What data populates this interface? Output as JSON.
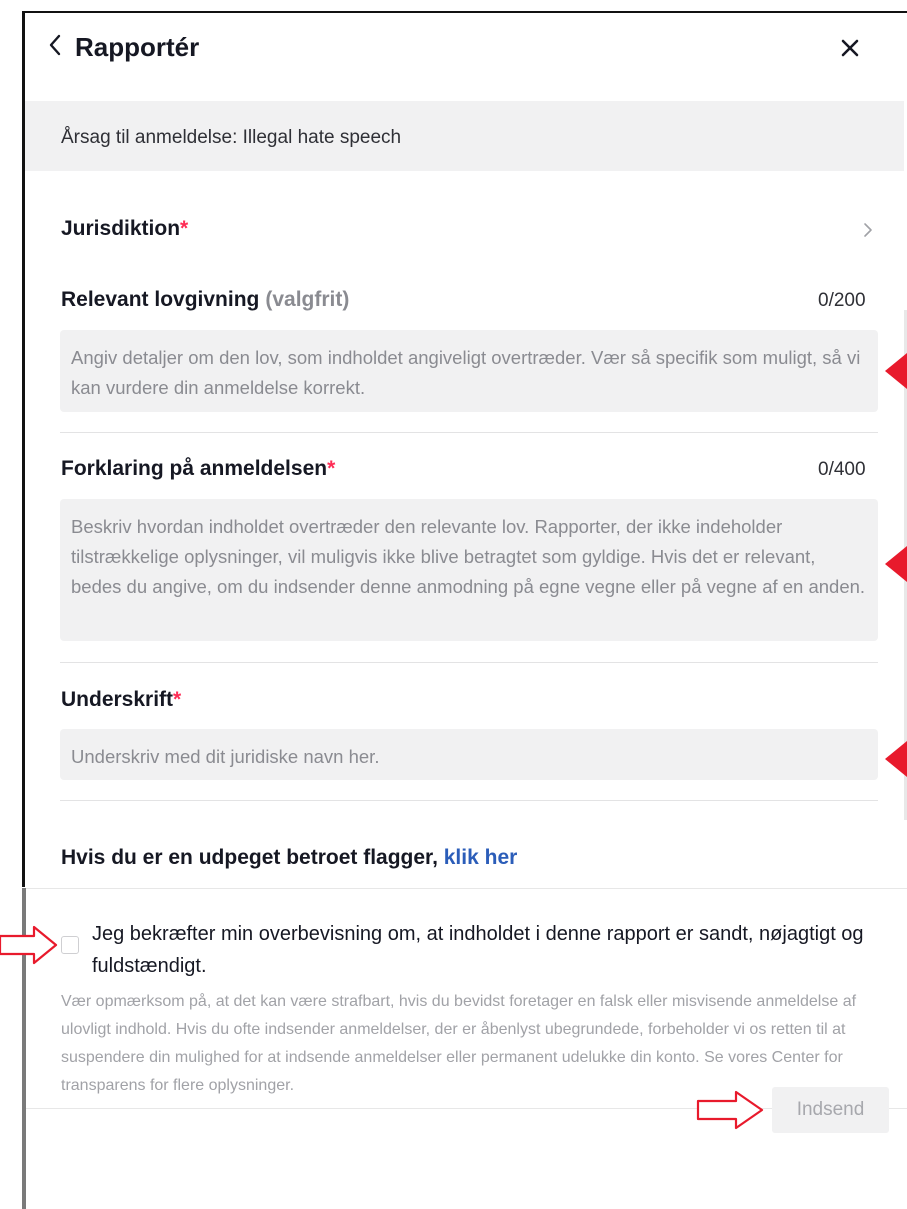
{
  "header": {
    "title": "Rapportér",
    "back_icon": "chevron-left-icon",
    "close_icon": "close-icon"
  },
  "reason": {
    "text": "Årsag til anmeldelse: Illegal hate speech"
  },
  "jurisdiction": {
    "label": "Jurisdiktion",
    "required_mark": "*"
  },
  "legislation": {
    "label": "Relevant lovgivning",
    "optional_label": "(valgfrit)",
    "counter": "0/200",
    "placeholder": "Angiv detaljer om den lov, som indholdet angiveligt overtræder. Vær så specifik som muligt, så vi kan vurdere din anmeldelse korrekt."
  },
  "explanation": {
    "label": "Forklaring på anmeldelsen",
    "required_mark": "*",
    "counter": "0/400",
    "placeholder": "Beskriv hvordan indholdet overtræder den relevante lov. Rapporter, der ikke indeholder tilstrækkelige oplysninger, vil muligvis ikke blive betragtet som gyldige. Hvis det er relevant, bedes du angive, om du indsender denne anmodning på egne vegne eller på vegne af en anden."
  },
  "signature": {
    "label": "Underskrift",
    "required_mark": "*",
    "placeholder": "Underskriv med dit juridiske navn her."
  },
  "flagger": {
    "text": "Hvis du er en udpeget betroet flagger,",
    "link": "klik her"
  },
  "confirm": {
    "checked": false,
    "text": "Jeg bekræfter min overbevisning om, at indholdet i denne rapport er sandt, nøjagtigt og fuldstændigt."
  },
  "legal_notice": "Vær opmærksom på, at det kan være strafbart, hvis du bevidst foretager en falsk eller misvisende anmeldelse af ulovligt indhold. Hvis du ofte indsender anmeldelser, der er åbenlyst ubegrundede, forbeholder vi os retten til at suspendere din mulighed for at indsende anmeldelser eller permanent udelukke din konto. Se vores Center for transparens for flere oplysninger.",
  "submit": {
    "label": "Indsend",
    "enabled": false
  },
  "colors": {
    "required": "#fe2c55",
    "link": "#2b5db9",
    "annotation_marker": "#e81a2c",
    "input_bg": "#f1f1f2"
  }
}
